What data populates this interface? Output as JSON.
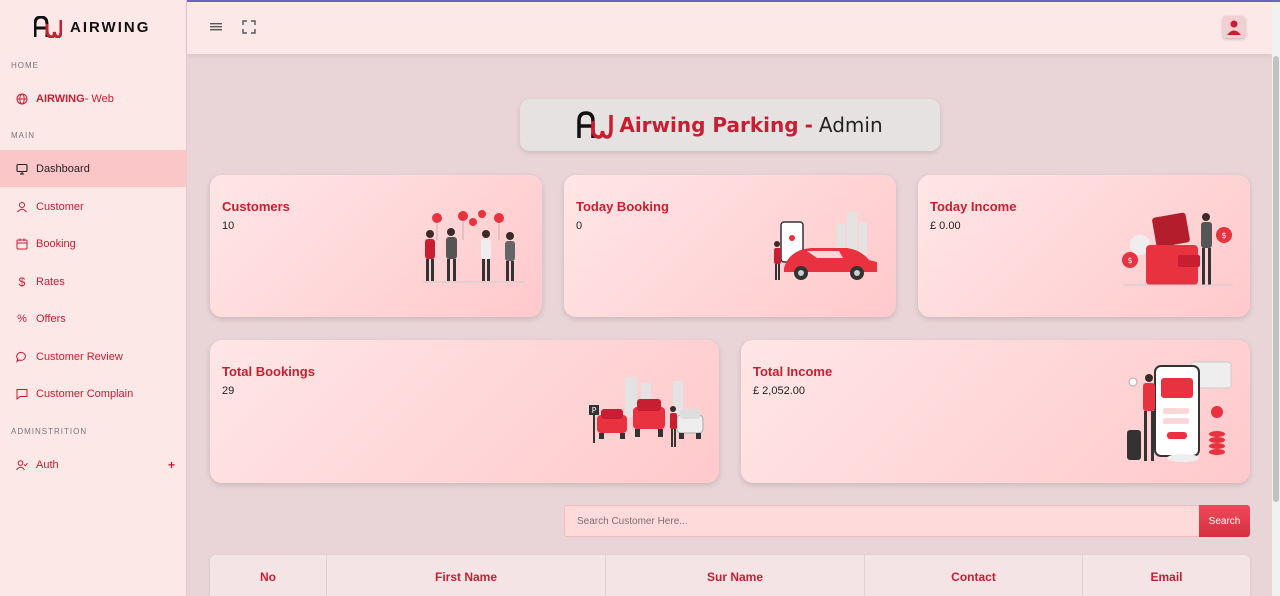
{
  "brand": {
    "name": "AIRWING"
  },
  "sidebar": {
    "sections": {
      "home": "HOME",
      "main": "MAIN",
      "admin": "ADMINSTRITION"
    },
    "web_link": {
      "brand": "AIRWING",
      "suffix": " - Web"
    },
    "items": [
      {
        "label": "Dashboard",
        "icon": "monitor-icon",
        "active": true
      },
      {
        "label": "Customer",
        "icon": "user-icon"
      },
      {
        "label": "Booking",
        "icon": "calendar-icon"
      },
      {
        "label": "Rates",
        "icon": "dollar-icon"
      },
      {
        "label": "Offers",
        "icon": "percent-icon"
      },
      {
        "label": "Customer Review",
        "icon": "chat-bubble-icon"
      },
      {
        "label": "Customer Complain",
        "icon": "message-square-icon"
      }
    ],
    "auth": {
      "label": "Auth",
      "expand": "+"
    }
  },
  "title": {
    "brand": "Airwing Parking",
    "sep": "-",
    "role": "Admin"
  },
  "cards": [
    {
      "title": "Customers",
      "value": "10"
    },
    {
      "title": "Today Booking",
      "value": "0"
    },
    {
      "title": "Today Income",
      "value": "£ 0.00"
    },
    {
      "title": "Total Bookings",
      "value": "29"
    },
    {
      "title": "Total Income",
      "value": "£ 2,052.00"
    }
  ],
  "search": {
    "placeholder": "Search Customer Here...",
    "button": "Search"
  },
  "table": {
    "headers": [
      "No",
      "First Name",
      "Sur Name",
      "Contact",
      "Email"
    ]
  },
  "colors": {
    "accent": "#c81e32",
    "sidebar_bg": "#fde8e8",
    "active_bg": "#fbc6c8",
    "page_bg": "#e9d5d7"
  }
}
